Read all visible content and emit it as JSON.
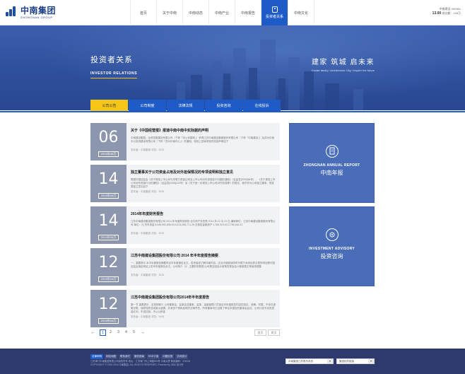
{
  "header": {
    "logo": {
      "cn": "中南集团",
      "en": "ZHONGNAN GROUP"
    },
    "nav": [
      {
        "label": "首页"
      },
      {
        "label": "关于中南"
      },
      {
        "label": "中南动态"
      },
      {
        "label": "中南产业"
      },
      {
        "label": "中南报告"
      },
      {
        "label": "投资者关系",
        "active": true,
        "icon": "investor-icon"
      },
      {
        "label": "中南文化"
      }
    ],
    "stock": {
      "name": "中南建设 000961",
      "price": "13.00",
      "volume_label": "成交额：",
      "volume": "148万"
    }
  },
  "banner": {
    "title_cn": "投资者关系",
    "title_en": "INVESTOR RELATIONS",
    "slogan_cn": "建家  筑城  启未来",
    "slogan_en": "Create family / Architecture City / Inspire the future"
  },
  "subtabs": [
    {
      "label": "公司公告",
      "active": true
    },
    {
      "label": "公司制度"
    },
    {
      "label": "法律法规"
    },
    {
      "label": "投资咨询"
    },
    {
      "label": "在线投诉"
    }
  ],
  "news": [
    {
      "day": "06",
      "ym": "2015年06月",
      "title": "关于《中国经营报》报道中南中南中实际据的声明",
      "summary": "中南建设集团，全资控股建设有限公司（下称「本公司建筑」）获得江苏中南建设集团股份有限公司（下称「中南建设」）及苏州中南中心投资建设有限公司（下称「苏州中南中心」）的通知。现就上述事项相关信息声明如下",
      "meta": "发布者：中南集团    浏览：3025"
    },
    {
      "day": "14",
      "ym": "2015年05月",
      "title": "独立董事关于公司资金占用及对外担保情况的专项说明和独立意见",
      "summary": "根据中国证监会《关于规范上市公司与关联方资金往来及上市公司对外担保若干问题的通知》（证监发[2003]56号）、《关于规范上市公司对外担保行为的通知》（证监发[2005]120号）及《关于进一步规范上市公司对外担保等》的规定，我们作为公司独立董事，现发表独立意见如下",
      "meta": "发布者：中南集团    浏览：3025"
    },
    {
      "day": "14",
      "ym": "2015年05月",
      "title": "2014年年度财务报告",
      "summary": "江苏中南建设集团股份有限公司 2014 年年度财务报告 合并资产负债表 2014 年 12 月 31 日 编制单位：江苏中南建设集团股份有限公司 单位：元 货币资金 6,546,551,836.00 6,674,066,771.28 交易性金融资产 2,766,323.63 2,796,245.22",
      "meta": "发布者：中南集团    浏览：3025"
    },
    {
      "day": "12",
      "ym": "2015年04月",
      "title": "江苏中南建设集团股份有限公司 2014 年半年度报告摘要",
      "summary": "一、重要提示 本半年度报告摘要来自半年度报告全文，投资者欲了解详细内容，应当仔细阅读同时刊载于深圳证券交易所网站等中国证监会指定网站上的半年度报告全文。公司简介（1）主要财务数据 公司是否因会计政策变更及会计差错更正等追溯调整",
      "meta": "发布者：中南集团    浏览：3025"
    },
    {
      "day": "12",
      "ym": "2015年04月",
      "title": "江苏中南建设集团股份有限公司2014年半年度报告",
      "summary": "第一节 重要提示、目录和释义 公司董事会、监事会及董事、监事、高级管理人员保证半年度报告内容的真实、准确、完整，不存在虚假记载、误导性陈述或重大遗漏，并承担个别和连带的法律责任。所有董事均已出席了审议本报告的董事会会议。公司计划不派发现金红利，不送红股，不以公积金",
      "meta": "发布者：中南集团    浏览：3025"
    }
  ],
  "pager": {
    "prev": "←",
    "pages": [
      "1",
      "2",
      "3",
      "4",
      "5"
    ],
    "current": "1",
    "next": "→",
    "first": "首页",
    "last": "尾页"
  },
  "cards": [
    {
      "en": "ZHONGNAN ANNUAL REPORT",
      "cn": "中南年报",
      "icon": "report-icon"
    },
    {
      "en": "INVESTMENT ADVISORY",
      "cn": "投资咨询",
      "icon": "advisory-icon"
    }
  ],
  "footer": {
    "links": [
      {
        "label": "法律申明",
        "active": true
      },
      {
        "label": "网站地图"
      },
      {
        "label": "联系我们"
      },
      {
        "label": "服务指南"
      },
      {
        "label": "RSS订阅"
      },
      {
        "label": "问题反馈"
      },
      {
        "label": "访问统计"
      }
    ],
    "copy1": "江苏海门中南集团有限公司版权所有  地址：江苏海门市上海路899号 中南大厦  邮政编码：226100",
    "copy2": "COPYRIGHT © 2002-2016 中南集团. ALL RIGHTS RESERVED. Powered by 2BIZ 设计所 ",
    "select1": "中南集团江苏股份系统",
    "select2": "集团相关链接"
  },
  "colors": {
    "brand_blue": "#1e5bc6",
    "accent_yellow": "#f5c518",
    "date_box": "#8c96ae",
    "card": "#4a6db9",
    "footer": "#2d3a6b"
  }
}
